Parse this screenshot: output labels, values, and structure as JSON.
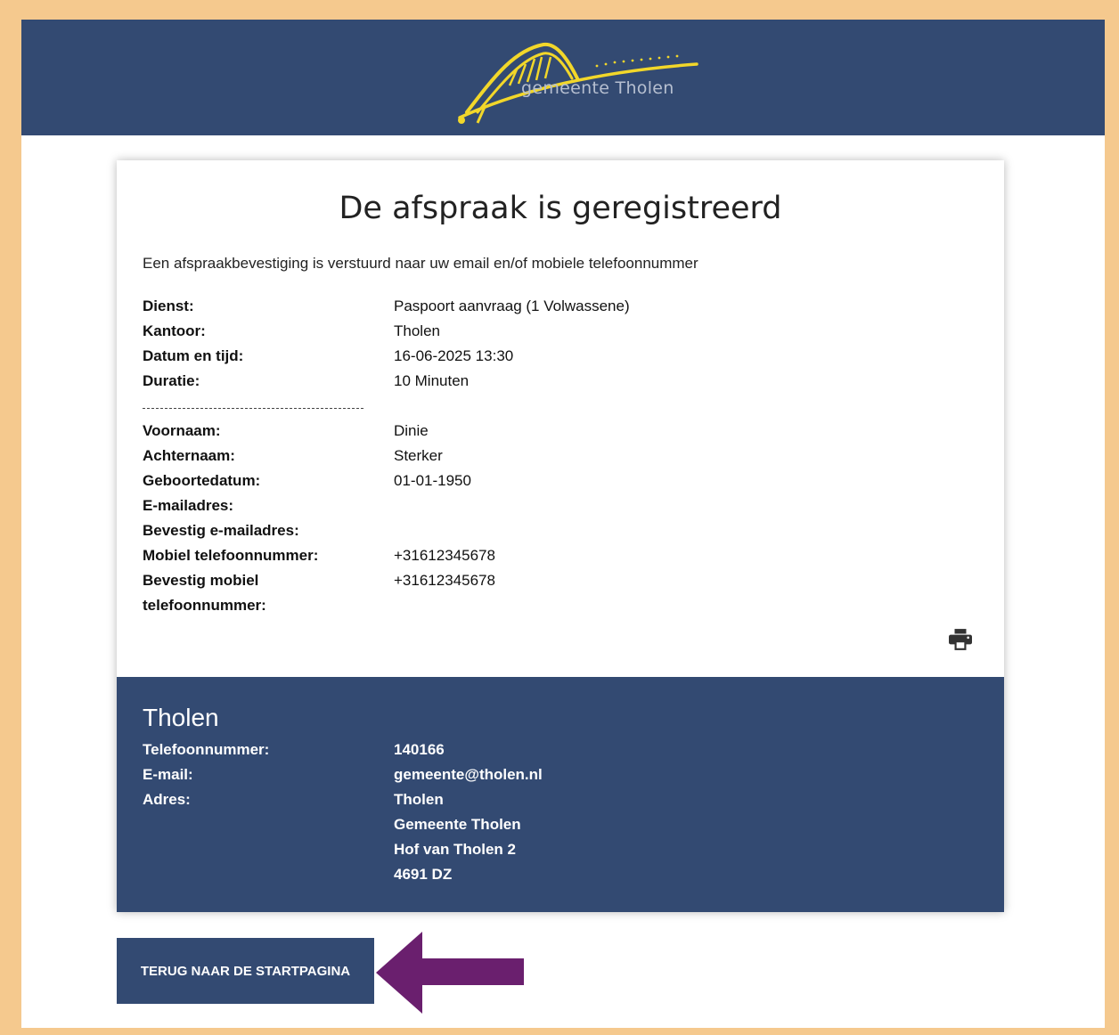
{
  "header": {
    "logo_text": "gemeente Tholen"
  },
  "confirmation": {
    "title": "De afspraak is geregistreerd",
    "intro": "Een afspraakbevestiging is verstuurd naar uw email en/of mobiele telefoonnummer",
    "appointment": [
      {
        "label": "Dienst:",
        "value": "Paspoort aanvraag (1 Volwassene)"
      },
      {
        "label": "Kantoor:",
        "value": "Tholen"
      },
      {
        "label": "Datum en tijd:",
        "value": "16-06-2025 13:30"
      },
      {
        "label": "Duratie:",
        "value": "10 Minuten"
      }
    ],
    "person": [
      {
        "label": "Voornaam:",
        "value": "Dinie"
      },
      {
        "label": "Achternaam:",
        "value": "Sterker"
      },
      {
        "label": "Geboortedatum:",
        "value": "01-01-1950"
      },
      {
        "label": "E-mailadres:",
        "value": ""
      },
      {
        "label": "Bevestig e-mailadres:",
        "value": ""
      },
      {
        "label": "Mobiel telefoonnummer:",
        "value": "+31612345678"
      },
      {
        "label_line1": "Bevestig mobiel",
        "label_line2": "telefoonnummer:",
        "value": "+31612345678"
      }
    ],
    "print_icon": "printer-icon"
  },
  "office": {
    "name": "Tholen",
    "phone_label": "Telefoonnummer:",
    "phone": "140166",
    "email_label": "E-mail:",
    "email": "gemeente@tholen.nl",
    "address_label": "Adres:",
    "address": [
      "Tholen",
      "Gemeente Tholen",
      "Hof van Tholen 2",
      "4691 DZ"
    ]
  },
  "back_button_label": "TERUG NAAR DE STARTPAGINA",
  "colors": {
    "brand_blue": "#334a72",
    "border": "#f5c98e",
    "logo_yellow": "#f2d72a",
    "arrow": "#6a1f6e"
  }
}
